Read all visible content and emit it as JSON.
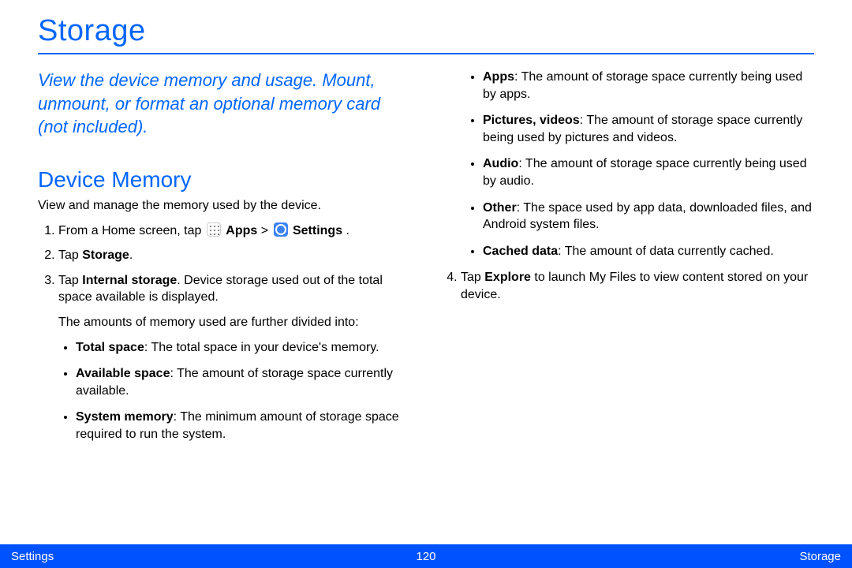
{
  "title": "Storage",
  "intro": "View the device memory and usage. Mount, unmount, or format an optional memory card (not included).",
  "section_heading": "Device Memory",
  "section_intro": "View and manage the memory used by the device.",
  "step1_prefix": "From a Home screen, tap ",
  "step1_apps": "Apps",
  "step1_gt": " > ",
  "step1_settings": "Settings",
  "step1_suffix": " .",
  "step2_prefix": "Tap ",
  "step2_bold": "Storage",
  "step2_suffix": ".",
  "step3_prefix": "Tap ",
  "step3_bold": "Internal storage",
  "step3_suffix": ". Device storage used out of the total space available is displayed.",
  "step3_para": "The amounts of memory used are further divided into:",
  "bullets_left": [
    {
      "label": "Total space",
      "desc": ": The total space in your device's memory."
    },
    {
      "label": "Available space",
      "desc": ": The amount of storage space currently available."
    },
    {
      "label": "System memory",
      "desc": ": The minimum amount of storage space required to run the system."
    }
  ],
  "bullets_right": [
    {
      "label": "Apps",
      "desc": ": The amount of storage space currently being used by apps."
    },
    {
      "label": "Pictures, videos",
      "desc": ": The amount of storage space currently being used by pictures and videos."
    },
    {
      "label": "Audio",
      "desc": ": The amount of storage space currently being used by audio."
    },
    {
      "label": "Other",
      "desc": ": The space used by app data, downloaded files, and Android system files."
    },
    {
      "label": "Cached data",
      "desc": ": The amount of data currently cached."
    }
  ],
  "step4_prefix": "Tap ",
  "step4_bold": "Explore",
  "step4_suffix": " to launch My Files to view content stored on your device.",
  "footer": {
    "left": "Settings",
    "center": "120",
    "right": "Storage"
  }
}
